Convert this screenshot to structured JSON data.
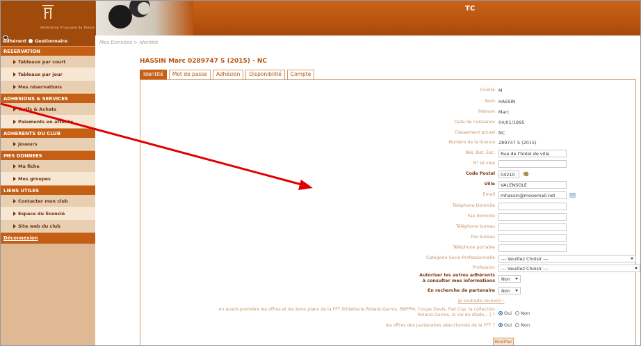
{
  "header": {
    "logo_text": "Fédération Française de Tennis",
    "site_title": "TC"
  },
  "sidebar": {
    "role_adherent": "Adhérent",
    "role_gestionnaire": "Gestionnaire",
    "sections": [
      {
        "title": "RESERVATION",
        "items": [
          "Tableaux par court",
          "Tableaux par jour",
          "Mes réservations"
        ]
      },
      {
        "title": "ADHESIONS & SERVICES",
        "items": [
          "Tarifs & Achats",
          "Paiements en attente"
        ]
      },
      {
        "title": "ADHERENTS DU CLUB",
        "items": [
          "Joueurs"
        ]
      },
      {
        "title": "MES DONNEES",
        "items": [
          "Ma fiche",
          "Mes groupes"
        ]
      },
      {
        "title": "LIENS UTILES",
        "items": [
          "Contacter mon club",
          "Espace du licencié",
          "Site web du club"
        ]
      }
    ],
    "logout": "Déconnexion"
  },
  "breadcrumb": "Mes Données > Identité",
  "page_title": "HASSIN Marc 0289747 S (2015) - NC",
  "tabs": [
    "Identité",
    "Mot de passe",
    "Adhésion",
    "Disponibilité",
    "Compte"
  ],
  "form": {
    "civilite_label": "Civilité",
    "civilite": "M",
    "nom_label": "Nom",
    "nom": "HASSIN",
    "prenom_label": "Prénom",
    "prenom": "Marc",
    "naissance_label": "Date de naissance",
    "naissance": "04/01/1995",
    "classement_label": "Classement actuel",
    "classement": "NC",
    "licence_label": "Numéro de la licence",
    "licence": "289747 S (2015)",
    "residence_label": "Rés. Bat. Esc.",
    "residence": "Rue de l'hotel de ville",
    "voie_label": "N° et voie",
    "voie": "",
    "cp_label": "Code Postal",
    "cp": "04210",
    "ville_label": "Ville",
    "ville": "VALENSOLE",
    "email_label": "Email",
    "email": "mhassin@monemail.net",
    "tel_dom_label": "Téléphone Domicile",
    "fax_dom_label": "Fax domicile",
    "tel_bur_label": "Téléphone bureau",
    "fax_bur_label": "Fax bureau",
    "tel_port_label": "Téléphone portable",
    "csp_label": "Catégorie Socio Professionnelle",
    "csp": "--- Veuillez Choisir ---",
    "profession_label": "Profession",
    "profession": "--- Veuillez Choisir ---",
    "autoriser_label_1": "Autoriser les autres adhérents",
    "autoriser_label_2": "à consulter mes informations",
    "autoriser": "Non",
    "partenaire_label": "En recherche de partenaire",
    "partenaire": "Non",
    "souhaite_link": "Je souhaite recevoir :",
    "offres_fft_1": "en avant-première les offres et les bons plans de la FFT (billetterie Roland-Garros, BNPPM, Coupe Davis, Fed Cup, la collection",
    "offres_fft_2": "Roland-Garros, la vie du stade,...) ?",
    "offres_part": "les offres des partenaires sélectionnés de la FFT ?",
    "oui": "Oui",
    "non": "Non",
    "modifier": "Modifier"
  }
}
